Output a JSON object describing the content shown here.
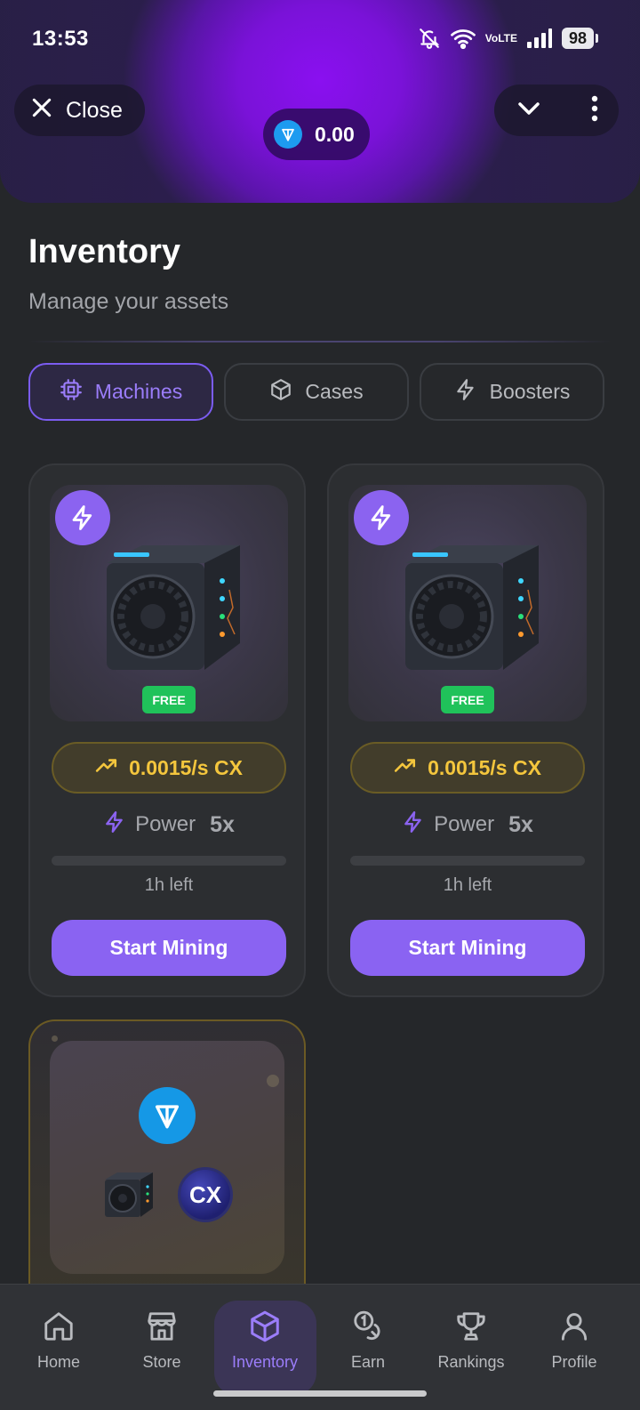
{
  "status_bar": {
    "time": "13:53",
    "volte_top": "Vo",
    "volte_bottom": "LTE",
    "battery": "98"
  },
  "header": {
    "close_label": "Close",
    "balance": "0.00"
  },
  "page": {
    "title": "Inventory",
    "subtitle": "Manage your assets"
  },
  "tabs": [
    {
      "label": "Machines",
      "icon": "cpu-icon",
      "active": true
    },
    {
      "label": "Cases",
      "icon": "box-icon",
      "active": false
    },
    {
      "label": "Boosters",
      "icon": "bolt-icon",
      "active": false
    }
  ],
  "machines": [
    {
      "badge": "FREE",
      "rate": "0.0015/s CX",
      "power_label": "Power",
      "power_value": "5x",
      "progress": 0,
      "time_left": "1h left",
      "button": "Start Mining"
    },
    {
      "badge": "FREE",
      "rate": "0.0015/s CX",
      "power_label": "Power",
      "power_value": "5x",
      "progress": 0,
      "time_left": "1h left",
      "button": "Start Mining"
    }
  ],
  "bundle": {
    "cx_label": "CX"
  },
  "bottom_nav": [
    {
      "label": "Home",
      "icon": "home-icon",
      "active": false
    },
    {
      "label": "Store",
      "icon": "store-icon",
      "active": false
    },
    {
      "label": "Inventory",
      "icon": "box-icon",
      "active": true
    },
    {
      "label": "Earn",
      "icon": "coins-icon",
      "active": false
    },
    {
      "label": "Rankings",
      "icon": "trophy-icon",
      "active": false
    },
    {
      "label": "Profile",
      "icon": "user-icon",
      "active": false
    }
  ],
  "colors": {
    "accent": "#8a63f2",
    "accent_text": "#9b7dfa",
    "rate_yellow": "#f4c63d",
    "free_green": "#20c25a",
    "background": "#25272a"
  }
}
